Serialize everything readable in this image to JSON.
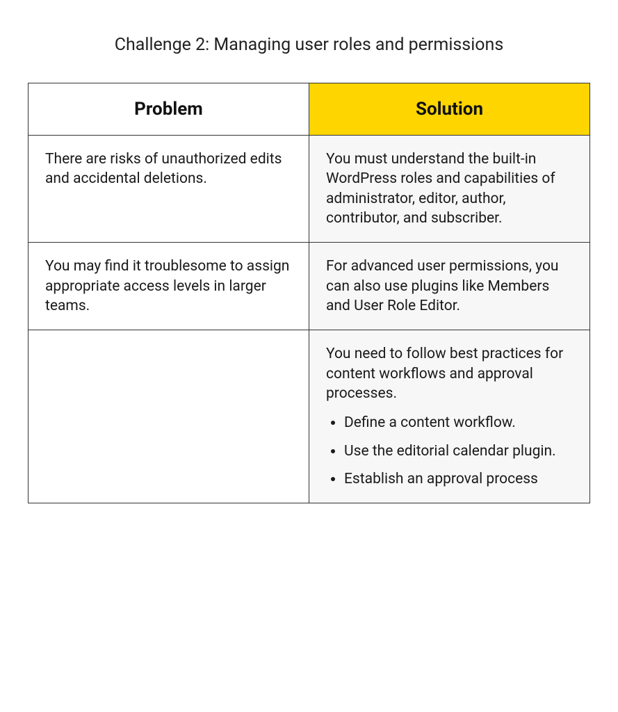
{
  "title": "Challenge 2: Managing user roles and permissions",
  "headers": {
    "problem": "Problem",
    "solution": "Solution"
  },
  "rows": [
    {
      "problem": "There are risks of unauthorized edits and accidental deletions.",
      "solution": "You must understand the built-in WordPress roles and capabilities of administrator, editor, author, contributor, and subscriber."
    },
    {
      "problem": "You may find it troublesome to assign appropriate access levels in larger teams.",
      "solution": "For advanced user permissions, you can also use plugins like Members and User Role Editor."
    },
    {
      "problem": "",
      "solution_intro": "You need to follow best practices for content workflows and approval processes.",
      "solution_bullets": [
        "Define a content workflow.",
        "Use the editorial calendar plugin.",
        "Establish an approval process"
      ]
    }
  ]
}
